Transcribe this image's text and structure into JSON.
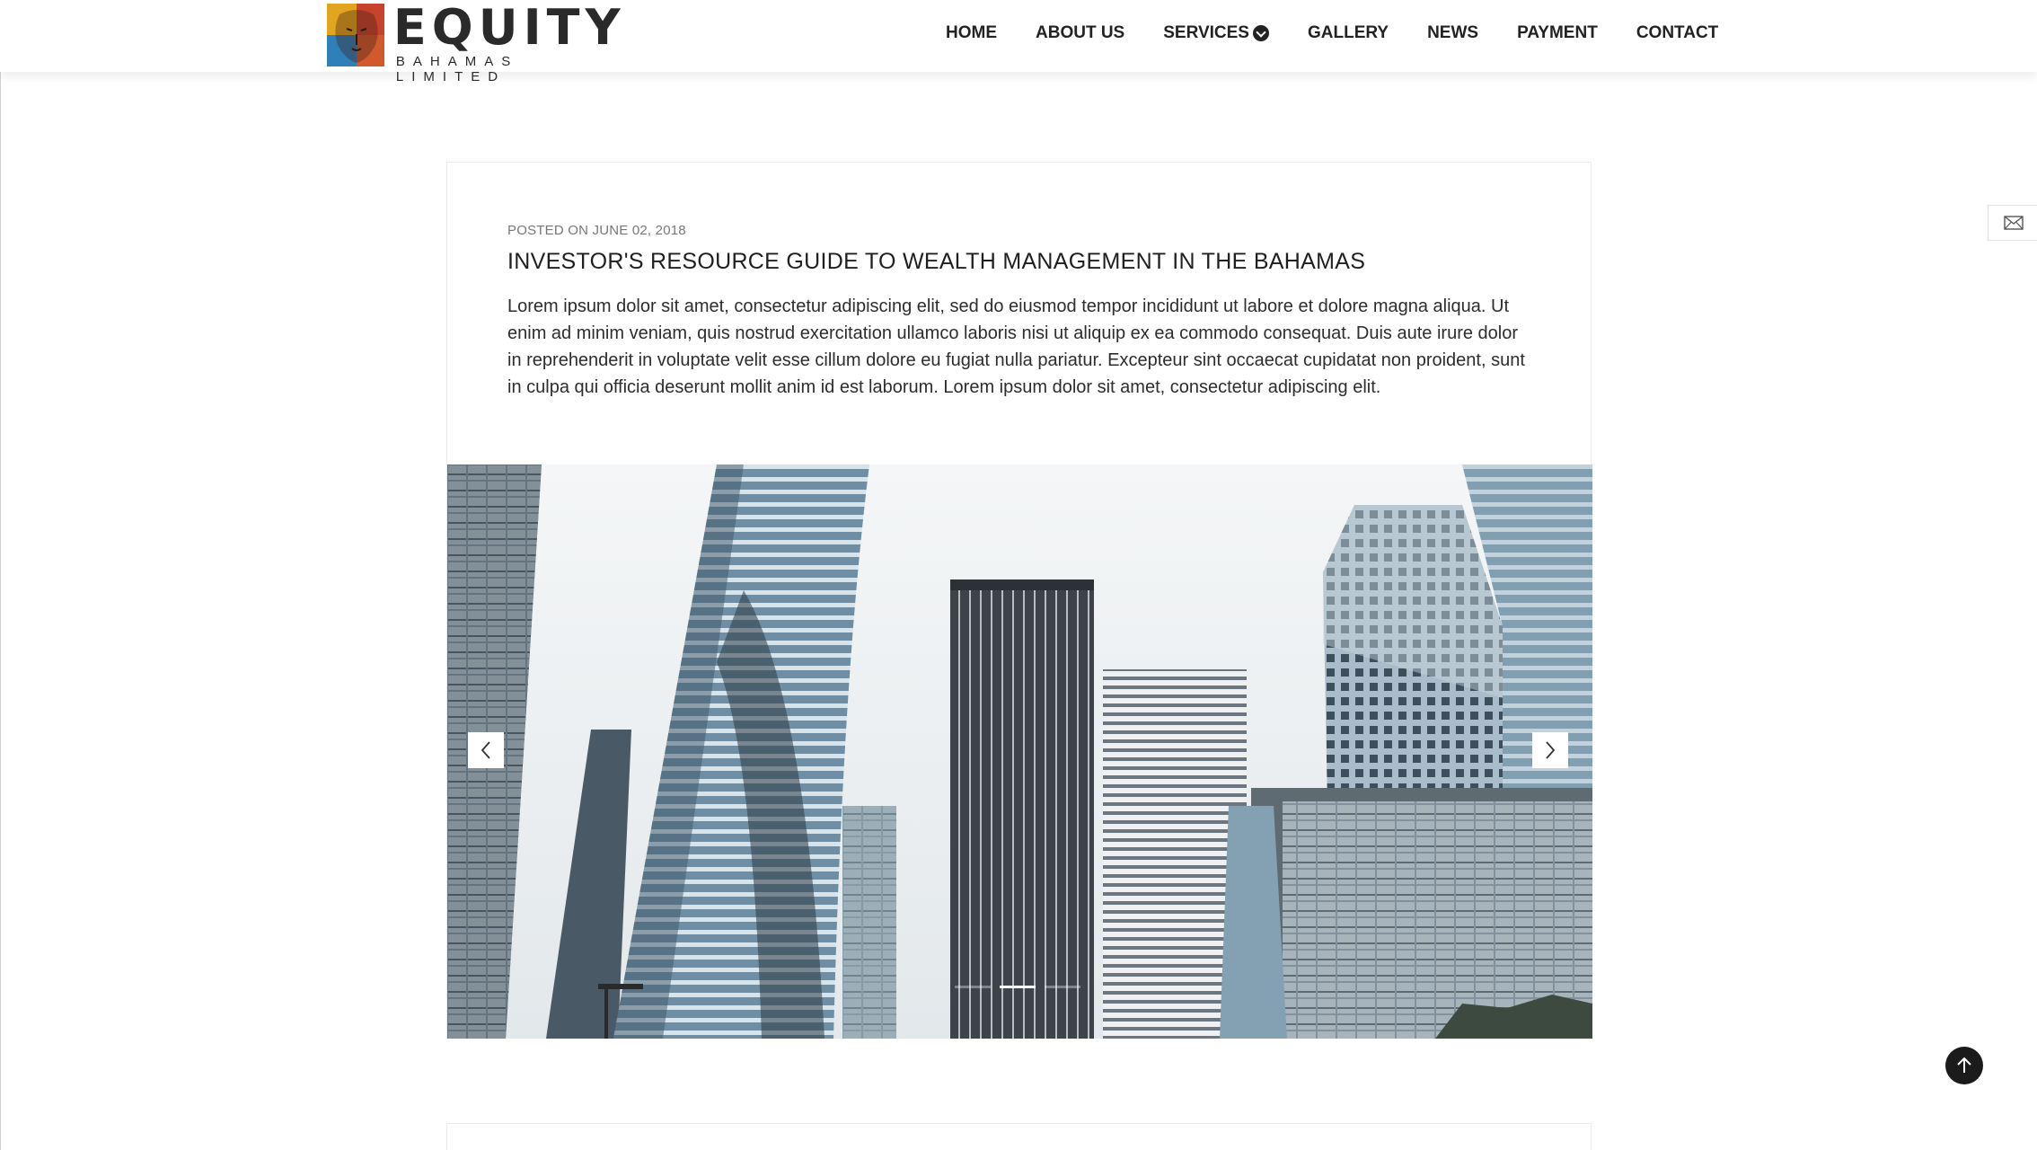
{
  "brand": {
    "title": "EQUITY",
    "subtitle": "BAHAMAS LIMITED"
  },
  "nav": {
    "items": [
      {
        "label": "HOME"
      },
      {
        "label": "ABOUT US"
      },
      {
        "label": "SERVICES",
        "has_dropdown": true
      },
      {
        "label": "GALLERY"
      },
      {
        "label": "NEWS"
      },
      {
        "label": "PAYMENT"
      },
      {
        "label": "CONTACT"
      }
    ]
  },
  "post": {
    "meta": "POSTED ON JUNE 02, 2018",
    "title": "INVESTOR'S RESOURCE GUIDE TO WEALTH MANAGEMENT IN THE BAHAMAS",
    "body": "Lorem ipsum dolor sit amet, consectetur adipiscing elit, sed do eiusmod tempor incididunt ut labore et dolore magna aliqua. Ut enim ad minim veniam, quis nostrud exercitation ullamco laboris nisi ut aliquip ex ea commodo consequat. Duis aute irure dolor in reprehenderit in voluptate velit esse cillum dolore eu fugiat nulla pariatur. Excepteur sint occaecat cupidatat non proident, sunt in culpa qui officia deserunt mollit anim id est laborum. Lorem ipsum dolor sit amet, consectetur adipiscing elit."
  },
  "slider": {
    "slide_count": 3,
    "active_slide": 2
  },
  "icons": {
    "dropdown": "chevron-circle-down-icon",
    "mail": "envelope-icon",
    "prev": "chevron-left-icon",
    "next": "chevron-right-icon",
    "top": "arrow-up-icon"
  },
  "colors": {
    "text": "#222222",
    "back_to_top": "#1b1b1b"
  }
}
